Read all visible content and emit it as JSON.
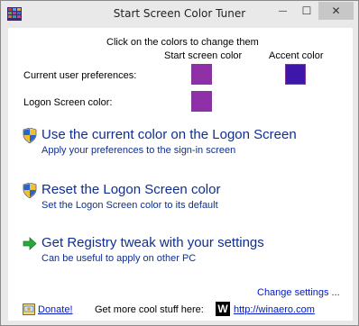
{
  "window": {
    "title": "Start Screen Color Tuner",
    "minimize_glyph": "—",
    "maximize_glyph": "☐",
    "close_glyph": "✕"
  },
  "colors": {
    "start_screen": "#8f30a6",
    "accent": "#3c17a9",
    "logon_screen": "#8f30a6",
    "link": "#0018c8",
    "command_text": "#0f2f8f"
  },
  "prefs": {
    "hint": "Click on the colors to change them",
    "col_start": "Start screen color",
    "col_accent": "Accent color",
    "row_current": "Current user preferences:",
    "row_logon": "Logon Screen color:"
  },
  "commands": [
    {
      "icon": "uac-shield-icon",
      "title": "Use the current color on the Logon Screen",
      "subtitle": "Apply your preferences to the sign-in screen"
    },
    {
      "icon": "uac-shield-icon",
      "title": "Reset the Logon Screen color",
      "subtitle": "Set the Logon Screen color to its default"
    },
    {
      "icon": "green-arrow-icon",
      "title": "Get Registry tweak with your settings",
      "subtitle": "Can be useful to apply on other PC"
    }
  ],
  "footer": {
    "change_settings": "Change settings ...",
    "donate": "Donate!",
    "more_stuff": "Get more cool stuff here:",
    "logo_letter": "W",
    "site": "http://winaero.com"
  }
}
